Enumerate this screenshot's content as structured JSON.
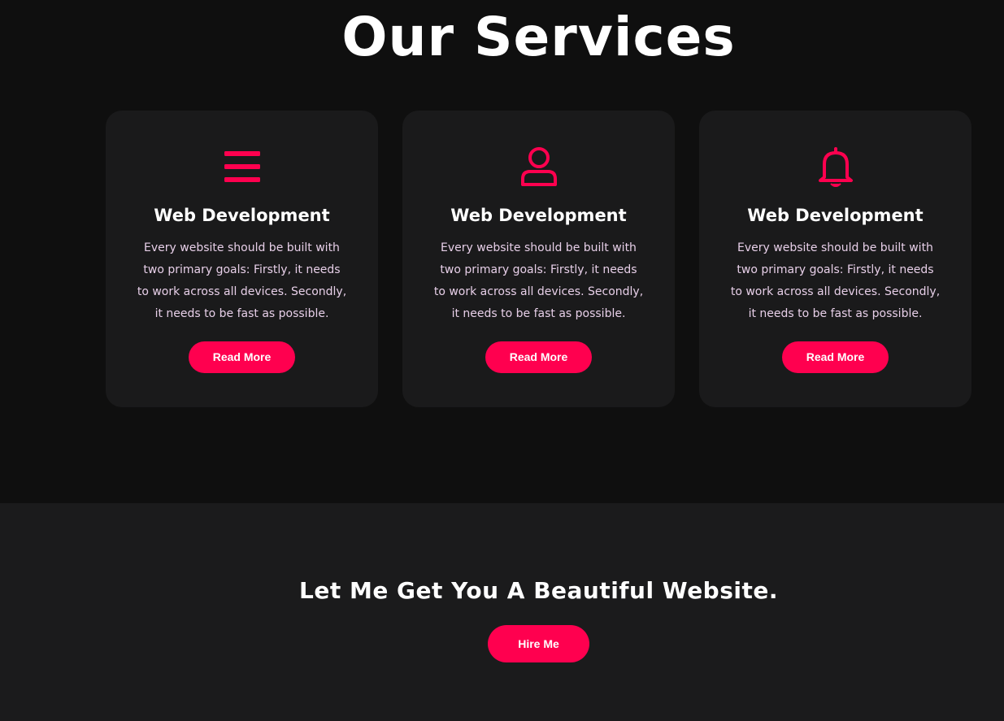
{
  "services": {
    "title": "Our Services",
    "cards": [
      {
        "icon": "menu-icon",
        "title": "Web Development",
        "text": "Every website should be built with\ntwo primary goals: Firstly, it needs\nto work across all devices. Secondly,\nit needs to be fast as possible.",
        "button": "Read More"
      },
      {
        "icon": "user-icon",
        "title": "Web Development",
        "text": "Every website should be built with\ntwo primary goals: Firstly, it needs\nto work across all devices. Secondly,\nit needs to be fast as possible.",
        "button": "Read More"
      },
      {
        "icon": "bell-icon",
        "title": "Web Development",
        "text": "Every website should be built with\ntwo primary goals: Firstly, it needs\nto work across all devices. Secondly,\nit needs to be fast as possible.",
        "button": "Read More"
      }
    ]
  },
  "cta": {
    "title": "Let Me Get You A Beautiful Website.",
    "button": "Hire Me"
  },
  "colors": {
    "background": "#0f0f0f",
    "card": "#1a1a1b",
    "accent": "#ff004f",
    "text_muted": "#e7cfe8"
  }
}
